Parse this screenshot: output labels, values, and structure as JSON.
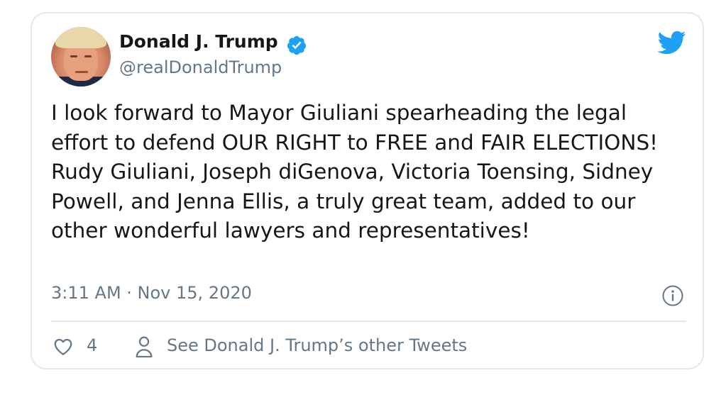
{
  "author": {
    "name": "Donald J. Trump",
    "handle": "@realDonaldTrump",
    "verified": true
  },
  "tweet": {
    "text": "I look forward to Mayor Giuliani spearheading the legal effort to defend OUR RIGHT to FREE and FAIR ELECTIONS! Rudy Giuliani, Joseph diGenova, Victoria Toensing, Sidney Powell, and Jenna Ellis, a truly great team, added to our other wonderful lawyers and representatives!",
    "timestamp": "3:11 AM · Nov 15, 2020"
  },
  "actions": {
    "like_count": "4",
    "other_tweets_label": "See Donald J. Trump’s other Tweets"
  },
  "icons": {
    "brand": "twitter-bird-icon",
    "verified": "verified-badge-icon",
    "info": "info-icon",
    "like": "heart-icon",
    "profile": "person-icon"
  },
  "colors": {
    "twitter_blue": "#1da1f2",
    "text_primary": "#14171a",
    "text_secondary": "#657786",
    "border": "#e1e8ed"
  }
}
